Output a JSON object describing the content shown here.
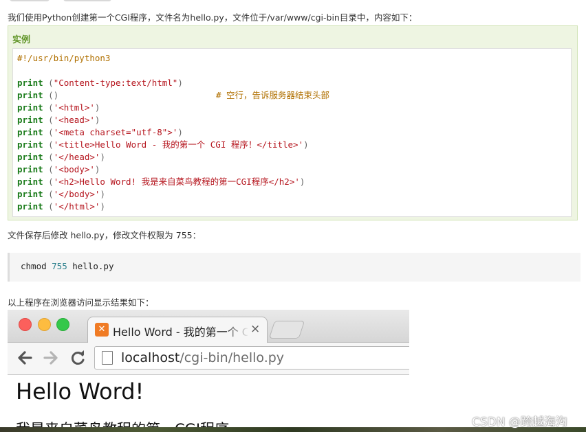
{
  "intro": "我们使用Python创建第一个CGI程序，文件名为hello.py，文件位于/var/www/cgi-bin目录中，内容如下：",
  "example": {
    "title": "实例",
    "shebang": "#!/usr/bin/python3",
    "lines": [
      {
        "kw": "print",
        "open": " (",
        "str": "\"Content-type:text/html\"",
        "close": ")",
        "comment": ""
      },
      {
        "kw": "print",
        "open": " ()",
        "str": "",
        "close": "",
        "comment": "# 空行，告诉服务器结束头部"
      },
      {
        "kw": "print",
        "open": " (",
        "str": "'<html>'",
        "close": ")",
        "comment": ""
      },
      {
        "kw": "print",
        "open": " (",
        "str": "'<head>'",
        "close": ")",
        "comment": ""
      },
      {
        "kw": "print",
        "open": " (",
        "str": "'<meta charset=\"utf-8\">'",
        "close": ")",
        "comment": ""
      },
      {
        "kw": "print",
        "open": " (",
        "str": "'<title>Hello Word - 我的第一个 CGI 程序！</title>'",
        "close": ")",
        "comment": ""
      },
      {
        "kw": "print",
        "open": " (",
        "str": "'</head>'",
        "close": ")",
        "comment": ""
      },
      {
        "kw": "print",
        "open": " (",
        "str": "'<body>'",
        "close": ")",
        "comment": ""
      },
      {
        "kw": "print",
        "open": " (",
        "str": "'<h2>Hello Word! 我是来自菜鸟教程的第一CGI程序</h2>'",
        "close": ")",
        "comment": ""
      },
      {
        "kw": "print",
        "open": " (",
        "str": "'</body>'",
        "close": ")",
        "comment": ""
      },
      {
        "kw": "print",
        "open": " (",
        "str": "'</html>'",
        "close": ")",
        "comment": ""
      }
    ]
  },
  "after_save": "文件保存后修改 hello.py，修改文件权限为 755：",
  "shell": {
    "cmd": "chmod ",
    "num": "755",
    "arg": " hello.py"
  },
  "result_intro": "以上程序在浏览器访问显示结果如下：",
  "browser": {
    "tab_title": "Hello Word - 我的第一个 CGI 程序！",
    "tab_close": "×",
    "url_host": "localhost",
    "url_path": "/cgi-bin/hello.py",
    "page_heading": "Hello Word!",
    "page_sub": "我是来自菜鸟教程的第一CGI程序"
  },
  "watermark": "CSDN @跨越海沟",
  "icons": {
    "back": "arrow-left",
    "forward": "arrow-right",
    "reload": "reload",
    "page": "page",
    "favicon": "xampp-logo"
  },
  "colors": {
    "accent_green": "#5f9426",
    "keyword": "#1a7b1a",
    "string": "#b5141d",
    "comment": "#b07000"
  }
}
